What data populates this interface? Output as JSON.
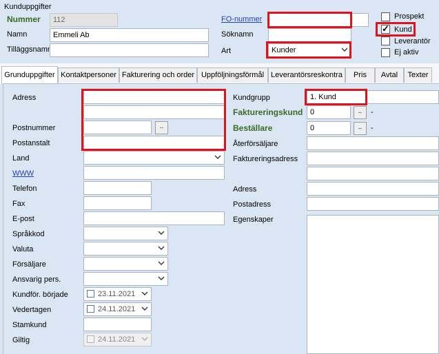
{
  "header": {
    "group_title": "Kunduppgifter",
    "nummer_label": "Nummer",
    "nummer_value": "112",
    "namn_label": "Namn",
    "namn_value": "Emmeli Ab",
    "tillaggsnamn_label": "Tilläggsnamn",
    "tillaggsnamn_value": "",
    "fo_nummer_label": "FO-nummer",
    "fo_nummer_value": "",
    "soknamn_label": "Söknamn",
    "soknamn_value": "",
    "art_label": "Art",
    "art_value": "Kunder",
    "prospekt_label": "Prospekt",
    "kund_label": "Kund",
    "leverantor_label": "Leverantör",
    "ej_aktiv_label": "Ej aktiv"
  },
  "tabs": [
    "Grunduppgifter",
    "Kontaktpersoner",
    "Fakturering och order",
    "Uppföljningsförmål",
    "Leverantörsreskontra",
    "Pris",
    "Avtal",
    "Texter"
  ],
  "left": {
    "adress_label": "Adress",
    "postnummer_label": "Postnummer",
    "postanstalt_label": "Postanstalt",
    "land_label": "Land",
    "www_label": "WWW",
    "telefon_label": "Telefon",
    "fax_label": "Fax",
    "epost_label": "E-post",
    "sprakkod_label": "Språkkod",
    "valuta_label": "Valuta",
    "forsaljare_label": "Försäljare",
    "ansvarig_label": "Ansvarig pers.",
    "kundfor_label": "Kundför. började",
    "kundfor_date": "23.11.2021",
    "vedertagen_label": "Vedertagen",
    "vedertagen_date": "24.11.2021",
    "stamkund_label": "Stamkund",
    "giltig_label": "Giltig",
    "giltig_date": "24.11.2021",
    "browse_label": ".."
  },
  "right": {
    "kundgrupp_label": "Kundgrupp",
    "kundgrupp_value": "1. Kund",
    "faktureringskund_label": "Faktureringskund",
    "faktureringskund_value": "0",
    "bestallare_label": "Beställare",
    "bestallare_value": "0",
    "dash": "-",
    "aterforsaljare_label": "Återförsäljare",
    "faktureringsadress_label": "Faktureringsadress",
    "adress_label": "Adress",
    "postadress_label": "Postadress",
    "egenskaper_label": "Egenskaper"
  },
  "colors": {
    "highlight": "#e0121a",
    "green_label": "#3a6b24",
    "link": "#1f3fbf",
    "panel": "#dbe6f4"
  }
}
